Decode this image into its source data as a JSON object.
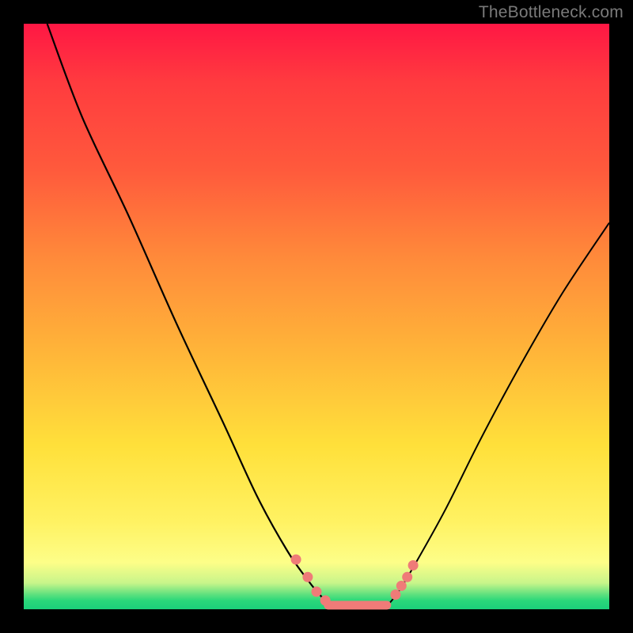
{
  "watermark": "TheBottleneck.com",
  "colors": {
    "background": "#000000",
    "gradient_top": "#ff1744",
    "gradient_mid": "#ffe03a",
    "gradient_bottom": "#1bd07a",
    "curve": "#000000",
    "marker": "#ef7b78"
  },
  "chart_data": {
    "type": "line",
    "title": "",
    "xlabel": "",
    "ylabel": "",
    "xlim": [
      0,
      100
    ],
    "ylim": [
      0,
      100
    ],
    "grid": false,
    "legend": false,
    "background_gradient": {
      "orientation": "vertical",
      "stops": [
        {
          "pos": 0.0,
          "color": "#ff1744",
          "meaning": "high-bottleneck"
        },
        {
          "pos": 0.5,
          "color": "#ffb239"
        },
        {
          "pos": 0.9,
          "color": "#fdfe88"
        },
        {
          "pos": 1.0,
          "color": "#1bd07a",
          "meaning": "optimal"
        }
      ]
    },
    "series": [
      {
        "name": "left-curve",
        "x": [
          4,
          10,
          18,
          26,
          34,
          40,
          45,
          48.5,
          51,
          53
        ],
        "y": [
          100,
          84,
          67,
          49,
          32,
          19,
          10,
          5,
          2,
          0.5
        ]
      },
      {
        "name": "right-curve",
        "x": [
          62,
          64,
          67,
          72,
          78,
          85,
          92,
          100
        ],
        "y": [
          0.5,
          3,
          8,
          17,
          29,
          42,
          54,
          66
        ]
      },
      {
        "name": "valley-floor",
        "x": [
          53,
          62
        ],
        "y": [
          0.5,
          0.5
        ]
      }
    ],
    "markers": [
      {
        "x": 46.5,
        "y": 8.5
      },
      {
        "x": 48.5,
        "y": 5.5
      },
      {
        "x": 50.0,
        "y": 3.0
      },
      {
        "x": 51.5,
        "y": 1.5
      },
      {
        "x": 63.5,
        "y": 2.5
      },
      {
        "x": 64.5,
        "y": 4.0
      },
      {
        "x": 65.5,
        "y": 5.5
      },
      {
        "x": 66.5,
        "y": 7.5
      }
    ],
    "marker_segments": [
      {
        "x1": 52,
        "y1": 0.7,
        "x2": 62,
        "y2": 0.7
      }
    ]
  }
}
